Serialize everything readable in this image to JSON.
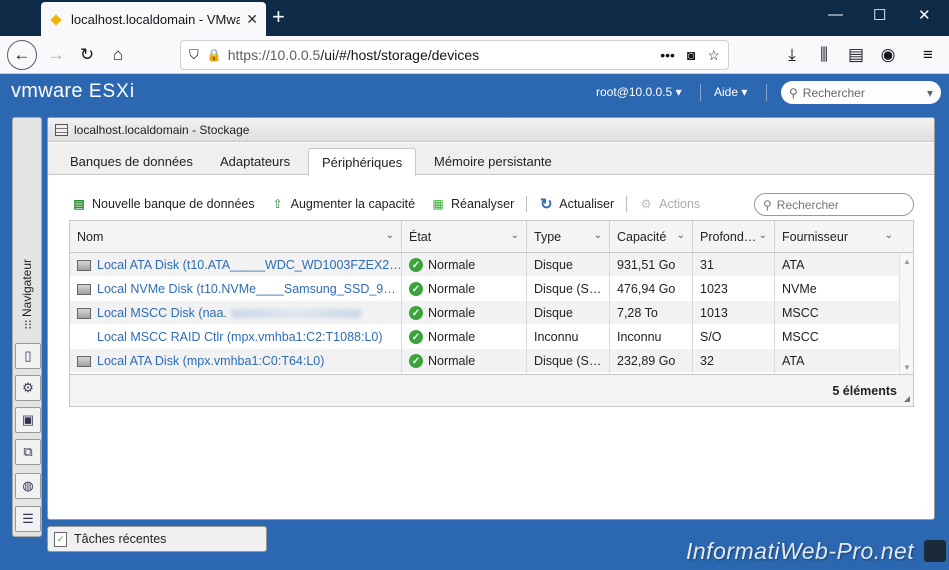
{
  "browser": {
    "tab_title": "localhost.localdomain - VMware",
    "url_host": "https://10.0.0.5",
    "url_path": "/ui/#/host/storage/devices"
  },
  "header": {
    "brand": "vmware",
    "product": "ESXi",
    "user": "root@10.0.0.5 ▾",
    "help": "Aide ▾",
    "search_placeholder": "Rechercher"
  },
  "navigator": {
    "label": "Navigateur"
  },
  "panel": {
    "title": "localhost.localdomain - Stockage",
    "tabs": [
      "Banques de données",
      "Adaptateurs",
      "Périphériques",
      "Mémoire persistante"
    ],
    "active_tab": "Périphériques"
  },
  "toolbar": {
    "new_datastore": "Nouvelle banque de données",
    "increase_capacity": "Augmenter la capacité",
    "rescan": "Réanalyser",
    "refresh": "Actualiser",
    "actions": "Actions",
    "search_placeholder": "Rechercher"
  },
  "grid": {
    "columns": [
      "Nom",
      "État",
      "Type",
      "Capacité",
      "Profond…",
      "Fournisseur"
    ],
    "rows": [
      {
        "name": "Local ATA Disk (t10.ATA_____WDC_WD1003FZEX2…",
        "state": "Normale",
        "type": "Disque",
        "capacity": "931,51 Go",
        "depth": "31",
        "vendor": "ATA"
      },
      {
        "name": "Local NVMe Disk (t10.NVMe____Samsung_SSD_9…",
        "state": "Normale",
        "type": "Disque (S…",
        "capacity": "476,94 Go",
        "depth": "1023",
        "vendor": "NVMe"
      },
      {
        "name": "Local MSCC Disk (naa.",
        "state": "Normale",
        "type": "Disque",
        "capacity": "7,28 To",
        "depth": "1013",
        "vendor": "MSCC"
      },
      {
        "name": "Local MSCC RAID Ctlr (mpx.vmhba1:C2:T1088:L0)",
        "state": "Normale",
        "type": "Inconnu",
        "capacity": "Inconnu",
        "depth": "S/O",
        "vendor": "MSCC"
      },
      {
        "name": "Local ATA Disk (mpx.vmhba1:C0:T64:L0)",
        "state": "Normale",
        "type": "Disque (S…",
        "capacity": "232,89 Go",
        "depth": "32",
        "vendor": "ATA"
      }
    ],
    "footer_count": "5 éléments"
  },
  "recent_tasks": "Tâches récentes",
  "watermark": "InformatiWeb-Pro.net"
}
